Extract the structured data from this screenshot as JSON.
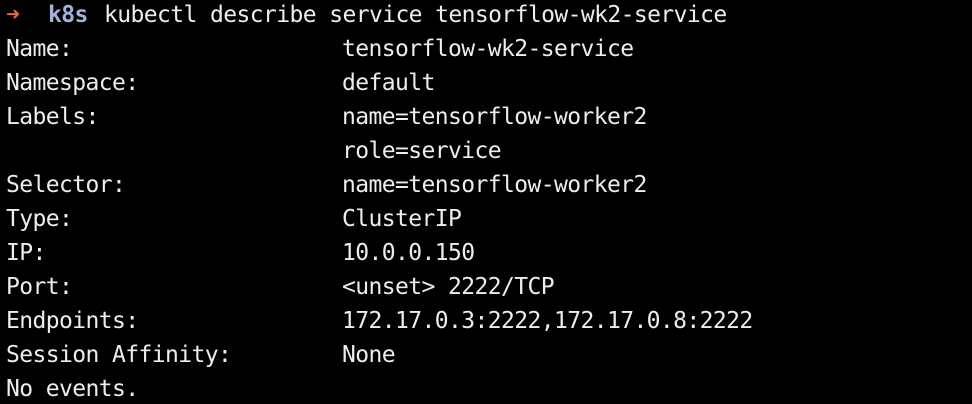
{
  "prompt": {
    "arrow": "➜",
    "context": "k8s",
    "command": "kubectl describe service tensorflow-wk2-service"
  },
  "output": [
    {
      "key": "Name:",
      "value": "tensorflow-wk2-service"
    },
    {
      "key": "Namespace:",
      "value": "default"
    },
    {
      "key": "Labels:",
      "value": "name=tensorflow-worker2"
    },
    {
      "key": "",
      "value": "role=service"
    },
    {
      "key": "Selector:",
      "value": "name=tensorflow-worker2"
    },
    {
      "key": "Type:",
      "value": "ClusterIP"
    },
    {
      "key": "IP:",
      "value": "10.0.0.150"
    },
    {
      "key": "Port:",
      "value": "<unset> 2222/TCP"
    },
    {
      "key": "Endpoints:",
      "value": "172.17.0.3:2222,172.17.0.8:2222"
    },
    {
      "key": "Session Affinity:",
      "value": "None"
    }
  ],
  "footer": "No events.",
  "colors": {
    "background": "#000000",
    "text": "#ededed",
    "prompt_arrow": "#e86c3c",
    "prompt_context": "#a6b3d9"
  }
}
